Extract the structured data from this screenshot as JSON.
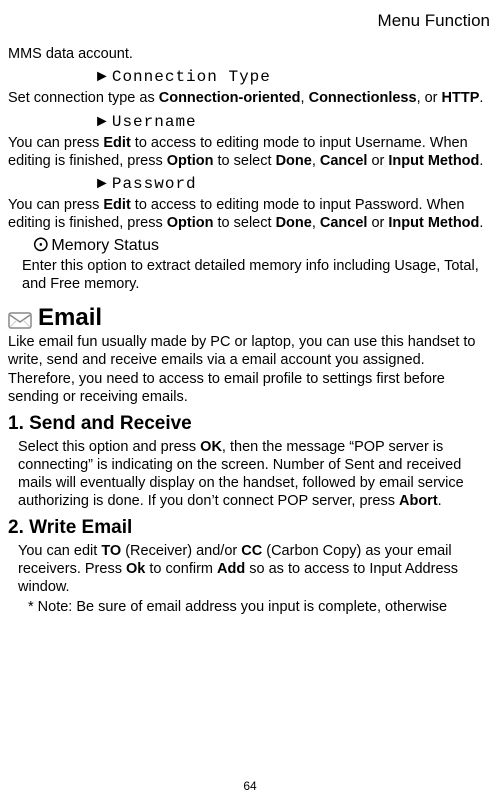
{
  "header": {
    "title": "Menu Function"
  },
  "intro_line": "MMS data account.",
  "conn_type": {
    "heading": "Connection Type",
    "text_parts": [
      "Set connection type as ",
      "Connection-oriented",
      ", ",
      "Connectionless",
      ", or ",
      "HTTP",
      "."
    ]
  },
  "username": {
    "heading": "Username",
    "text_parts": [
      "You can press ",
      "Edit",
      " to access to editing mode to input Username. When editing is finished, press ",
      "Option",
      " to select ",
      "Done",
      ", ",
      "Cancel",
      " or ",
      "Input Method",
      "."
    ]
  },
  "password": {
    "heading": "Password",
    "text_parts": [
      "You can press ",
      "Edit",
      " to access to editing mode to input Password. When editing is finished, press ",
      "Option",
      " to select ",
      "Done",
      ", ",
      "Cancel",
      " or ",
      "Input Method",
      "."
    ]
  },
  "memory_status": {
    "heading": "Memory Status",
    "text": "Enter this option to extract detailed memory info including Usage, Total, and Free memory."
  },
  "email": {
    "heading": "Email",
    "intro": "Like email fun usually made by PC or laptop, you can use this handset to write, send and receive emails via a email account you assigned. Therefore, you need to access to email profile to settings first before sending or receiving emails."
  },
  "send_receive": {
    "heading": "1. Send and Receive",
    "text_parts": [
      "Select this option and press ",
      "OK",
      ", then the message “POP server is connecting” is indicating on the screen. Number of Sent and received mails will eventually display on the handset, followed by email service authorizing is done. If you don’t connect POP server, press ",
      "Abort",
      "."
    ]
  },
  "write_email": {
    "heading": "2. Write Email",
    "text_parts": [
      "You can edit ",
      "TO",
      " (Receiver) and/or ",
      "CC",
      " (Carbon Copy) as your email receivers. Press ",
      "Ok",
      " to confirm ",
      "Add",
      " so as to access to Input Address window."
    ],
    "note": "* Note: Be sure of email address you input is complete, otherwise"
  },
  "page_number": "64",
  "arrow": "►",
  "bullet": "⊙"
}
